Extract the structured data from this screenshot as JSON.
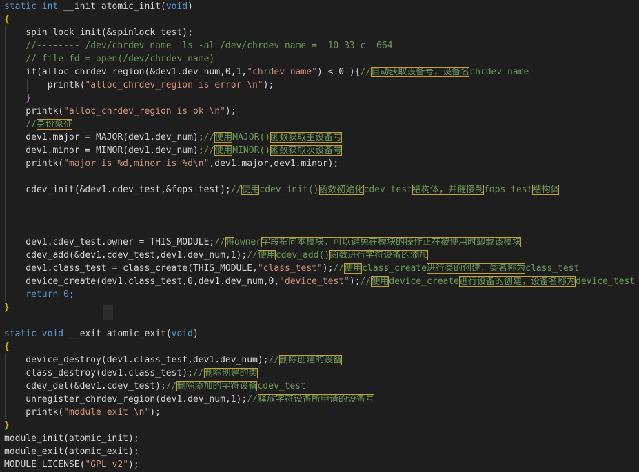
{
  "editor": {
    "language": "c",
    "colors": {
      "background": "#1e1e1e",
      "keyword": "#569cd6",
      "string": "#ce9178",
      "number": "#b5cea8",
      "comment": "#6a9955",
      "text": "#d4d4d4",
      "brace": "#ffd700",
      "highlight_border": "#c8a032"
    },
    "lines": [
      [
        {
          "t": "static int ",
          "c": "kw"
        },
        {
          "t": "__init atomic_init(",
          "c": "id"
        },
        {
          "t": "void",
          "c": "kw"
        },
        {
          "t": ")",
          "c": "id"
        }
      ],
      [
        {
          "t": "{",
          "c": "brace"
        }
      ],
      [
        {
          "t": "    spin_lock_init(&spinlock_test);",
          "c": "id"
        }
      ],
      [
        {
          "t": "    //-------- /dev/chrdev_name  ls -al /dev/chrdev_name =  10 33 c  664",
          "c": "cmt"
        }
      ],
      [
        {
          "t": "    // file fd = open(/dev/chrdev_name)",
          "c": "cmt"
        }
      ],
      [
        {
          "t": "    if(alloc_chrdev_region(&dev1.dev_num,0,1,",
          "c": "id"
        },
        {
          "t": "\"chrdev_name\"",
          "c": "str"
        },
        {
          "t": ") < 0 ){",
          "c": "id"
        },
        {
          "t": "//",
          "c": "cmt"
        },
        {
          "t": "自动获取设备号，设备名",
          "c": "hl"
        },
        {
          "t": "chrdev_name",
          "c": "cmt"
        }
      ],
      [
        {
          "t": "        printk(",
          "c": "id"
        },
        {
          "t": "\"alloc_chrdev_region is error \\n\"",
          "c": "str"
        },
        {
          "t": ");",
          "c": "id"
        }
      ],
      [
        {
          "t": "    }",
          "c": "brace2"
        }
      ],
      [
        {
          "t": "    printk(",
          "c": "id"
        },
        {
          "t": "\"alloc_chrdev_region is ok \\n\"",
          "c": "str"
        },
        {
          "t": ");",
          "c": "id"
        }
      ],
      [
        {
          "t": "    //",
          "c": "cmt"
        },
        {
          "t": "身份象征",
          "c": "hl"
        }
      ],
      [
        {
          "t": "    dev1.major = MAJOR(dev1.dev_num);",
          "c": "id"
        },
        {
          "t": "//",
          "c": "cmt"
        },
        {
          "t": "使用",
          "c": "hl"
        },
        {
          "t": "MAJOR()",
          "c": "cmt"
        },
        {
          "t": "函数获取主设备号",
          "c": "hl"
        }
      ],
      [
        {
          "t": "    dev1.minor = MINOR(dev1.dev_num);",
          "c": "id"
        },
        {
          "t": "//",
          "c": "cmt"
        },
        {
          "t": "使用",
          "c": "hl"
        },
        {
          "t": "MINOR()",
          "c": "cmt"
        },
        {
          "t": "函数获取次设备号",
          "c": "hl"
        }
      ],
      [
        {
          "t": "    printk(",
          "c": "id"
        },
        {
          "t": "\"major is %d,minor is %d\\n\"",
          "c": "str"
        },
        {
          "t": ",dev1.major,dev1.minor);",
          "c": "id"
        }
      ],
      [],
      [
        {
          "t": "    cdev_init(&dev1.cdev_test,&fops_test);",
          "c": "id"
        },
        {
          "t": "//",
          "c": "cmt"
        },
        {
          "t": "使用",
          "c": "hl"
        },
        {
          "t": "cdev_init()",
          "c": "cmt"
        },
        {
          "t": "函数初始化",
          "c": "hl"
        },
        {
          "t": "cdev_test",
          "c": "cmt"
        },
        {
          "t": "结构体，并链接到",
          "c": "hl"
        },
        {
          "t": "fops_test",
          "c": "cmt"
        },
        {
          "t": "结构体",
          "c": "hl"
        }
      ],
      [],
      [],
      [],
      [
        {
          "t": "    dev1.cdev_test.owner = THIS_MODULE;",
          "c": "id"
        },
        {
          "t": "//",
          "c": "cmt"
        },
        {
          "t": "将",
          "c": "hl"
        },
        {
          "t": "owner",
          "c": "cmt"
        },
        {
          "t": "字段指向本模块，可以避免在模块的操作正在被使用时卸载该模块",
          "c": "hl"
        }
      ],
      [
        {
          "t": "    cdev_add(&dev1.cdev_test,dev1.dev_num,1);",
          "c": "id"
        },
        {
          "t": "//",
          "c": "cmt"
        },
        {
          "t": "使用",
          "c": "hl"
        },
        {
          "t": "cdev_add()",
          "c": "cmt"
        },
        {
          "t": "函数进行字符设备的添加",
          "c": "hl"
        }
      ],
      [
        {
          "t": "    dev1.class_test = class_create(THIS_MODULE,",
          "c": "id"
        },
        {
          "t": "\"class_test\"",
          "c": "str"
        },
        {
          "t": ");",
          "c": "id"
        },
        {
          "t": "//",
          "c": "cmt"
        },
        {
          "t": "使用",
          "c": "hl"
        },
        {
          "t": "class_create",
          "c": "cmt"
        },
        {
          "t": "进行类的创建，类名称为",
          "c": "hl"
        },
        {
          "t": "class_test",
          "c": "cmt"
        }
      ],
      [
        {
          "t": "    device_create(dev1.class_test,0,dev1.dev_num,0,",
          "c": "id"
        },
        {
          "t": "\"device_test\"",
          "c": "str"
        },
        {
          "t": ");",
          "c": "id"
        },
        {
          "t": "//",
          "c": "cmt"
        },
        {
          "t": "使用",
          "c": "hl"
        },
        {
          "t": "device_create",
          "c": "cmt"
        },
        {
          "t": "进行设备的创建，设备名称为",
          "c": "hl"
        },
        {
          "t": "device_test",
          "c": "cmt"
        }
      ],
      [
        {
          "t": "    return 0;",
          "c": "kw"
        }
      ],
      [
        {
          "t": "}",
          "c": "brace"
        }
      ],
      [],
      [
        {
          "t": "static void ",
          "c": "kw"
        },
        {
          "t": "__exit atomic_exit(",
          "c": "id"
        },
        {
          "t": "void",
          "c": "kw"
        },
        {
          "t": ")",
          "c": "id"
        }
      ],
      [
        {
          "t": "{",
          "c": "brace"
        }
      ],
      [
        {
          "t": "    device_destroy(dev1.class_test,dev1.dev_num);",
          "c": "id"
        },
        {
          "t": "//",
          "c": "cmt"
        },
        {
          "t": "删除创建的设备",
          "c": "hl"
        }
      ],
      [
        {
          "t": "    class_destroy(dev1.class_test);",
          "c": "id"
        },
        {
          "t": "//",
          "c": "cmt"
        },
        {
          "t": "删除创建的类",
          "c": "hl"
        }
      ],
      [
        {
          "t": "    cdev_del(&dev1.cdev_test);",
          "c": "id"
        },
        {
          "t": "//",
          "c": "cmt"
        },
        {
          "t": "删除添加的字符设备",
          "c": "hl"
        },
        {
          "t": "cdev_test",
          "c": "cmt"
        }
      ],
      [
        {
          "t": "    unregister_chrdev_region(dev1.dev_num,1);",
          "c": "id"
        },
        {
          "t": "//",
          "c": "cmt"
        },
        {
          "t": "释放字符设备所申请的设备号",
          "c": "hl"
        }
      ],
      [
        {
          "t": "    printk(",
          "c": "id"
        },
        {
          "t": "\"module exit \\n\"",
          "c": "str"
        },
        {
          "t": ");",
          "c": "id"
        }
      ],
      [
        {
          "t": "}",
          "c": "brace"
        }
      ],
      [
        {
          "t": "module_init(atomic_init);",
          "c": "id"
        }
      ],
      [
        {
          "t": "module_exit(atomic_exit);",
          "c": "id"
        }
      ],
      [
        {
          "t": "MODULE_LICENSE(",
          "c": "id"
        },
        {
          "t": "\"GPL v2\"",
          "c": "str"
        },
        {
          "t": ");",
          "c": "id"
        }
      ]
    ]
  }
}
